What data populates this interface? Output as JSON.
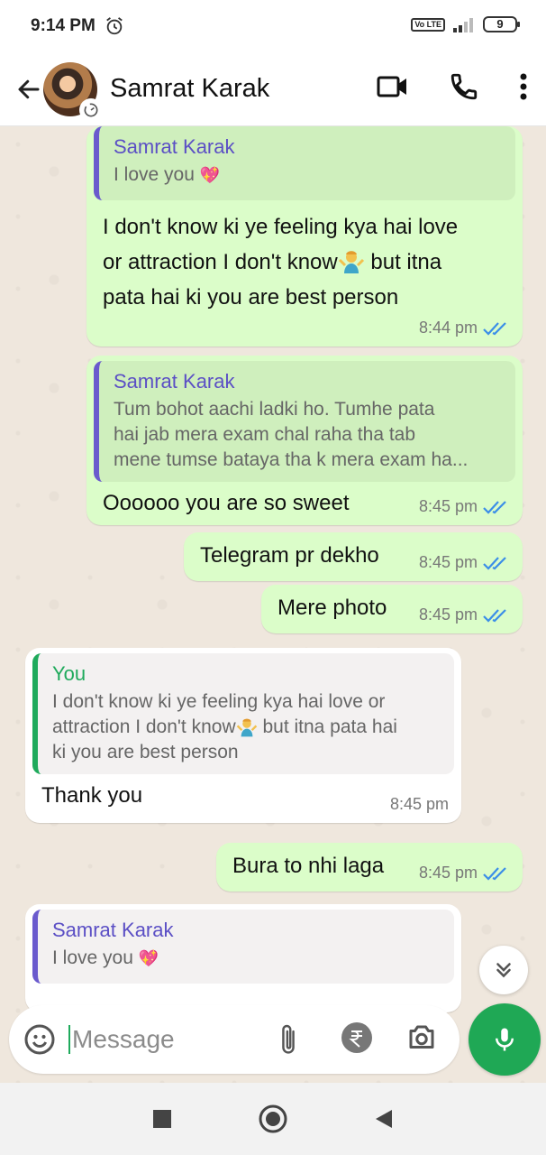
{
  "status_bar": {
    "time": "9:14 PM",
    "network": "Vo LTE",
    "battery": "9"
  },
  "header": {
    "contact_name": "Samrat Karak"
  },
  "messages": [
    {
      "direction": "out",
      "quote_author": "Samrat Karak",
      "quote_text": "I love you",
      "text_line1": "I don't know ki ye feeling kya hai love",
      "text_line2a": "or attraction I don't know",
      "text_line2b": " but itna",
      "text_line3": "pata hai ki you are best person",
      "time": "8:44 pm"
    },
    {
      "direction": "out",
      "quote_author": "Samrat Karak",
      "quote_line1": "Tum bohot aachi ladki ho. Tumhe pata",
      "quote_line2": "hai jab mera exam chal raha tha tab",
      "quote_line3": "mene tumse bataya tha k mera exam ha...",
      "text": "Oooooo you are so sweet",
      "time": "8:45 pm"
    },
    {
      "direction": "out",
      "text": "Telegram pr dekho",
      "time": "8:45 pm"
    },
    {
      "direction": "out",
      "text": "Mere photo",
      "time": "8:45 pm"
    },
    {
      "direction": "in",
      "quote_author": "You",
      "quote_line1": "I don't know ki ye feeling kya hai love or",
      "quote_line2a": "attraction I don't know",
      "quote_line2b": " but itna pata hai",
      "quote_line3": "ki you are best person",
      "text": "Thank you",
      "time": "8:45 pm"
    },
    {
      "direction": "out",
      "text": "Bura to nhi laga",
      "time": "8:45 pm"
    },
    {
      "direction": "in",
      "quote_author": "Samrat Karak",
      "quote_text": "I love you"
    }
  ],
  "composer": {
    "placeholder": "Message"
  },
  "colors": {
    "outgoing_bubble": "#dbfdc9",
    "incoming_bubble": "#ffffff",
    "accent_green": "#1fa855",
    "quote_author_purple": "#5b4fc5",
    "read_tick_blue": "#3b8ee8"
  }
}
